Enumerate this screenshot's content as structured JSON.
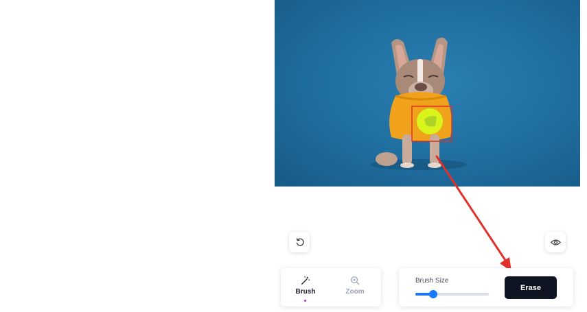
{
  "toolbar": {
    "undo_icon": "rotate-ccw-icon",
    "preview_icon": "eye-icon"
  },
  "tools": {
    "brush": {
      "label": "Brush",
      "icon": "magic-wand-icon",
      "active": true
    },
    "zoom": {
      "label": "Zoom",
      "icon": "zoom-in-icon",
      "active": false
    }
  },
  "brush_size": {
    "label": "Brush Size",
    "value_fraction": 0.24
  },
  "actions": {
    "erase_label": "Erase"
  },
  "colors": {
    "accent": "#1677ff",
    "erase_button": "#0f1422",
    "canvas_background": "#1f6d9f",
    "annotation": "#e0302a",
    "brush_highlight": "#d4ff1a",
    "active_dot": "#c026d3"
  }
}
